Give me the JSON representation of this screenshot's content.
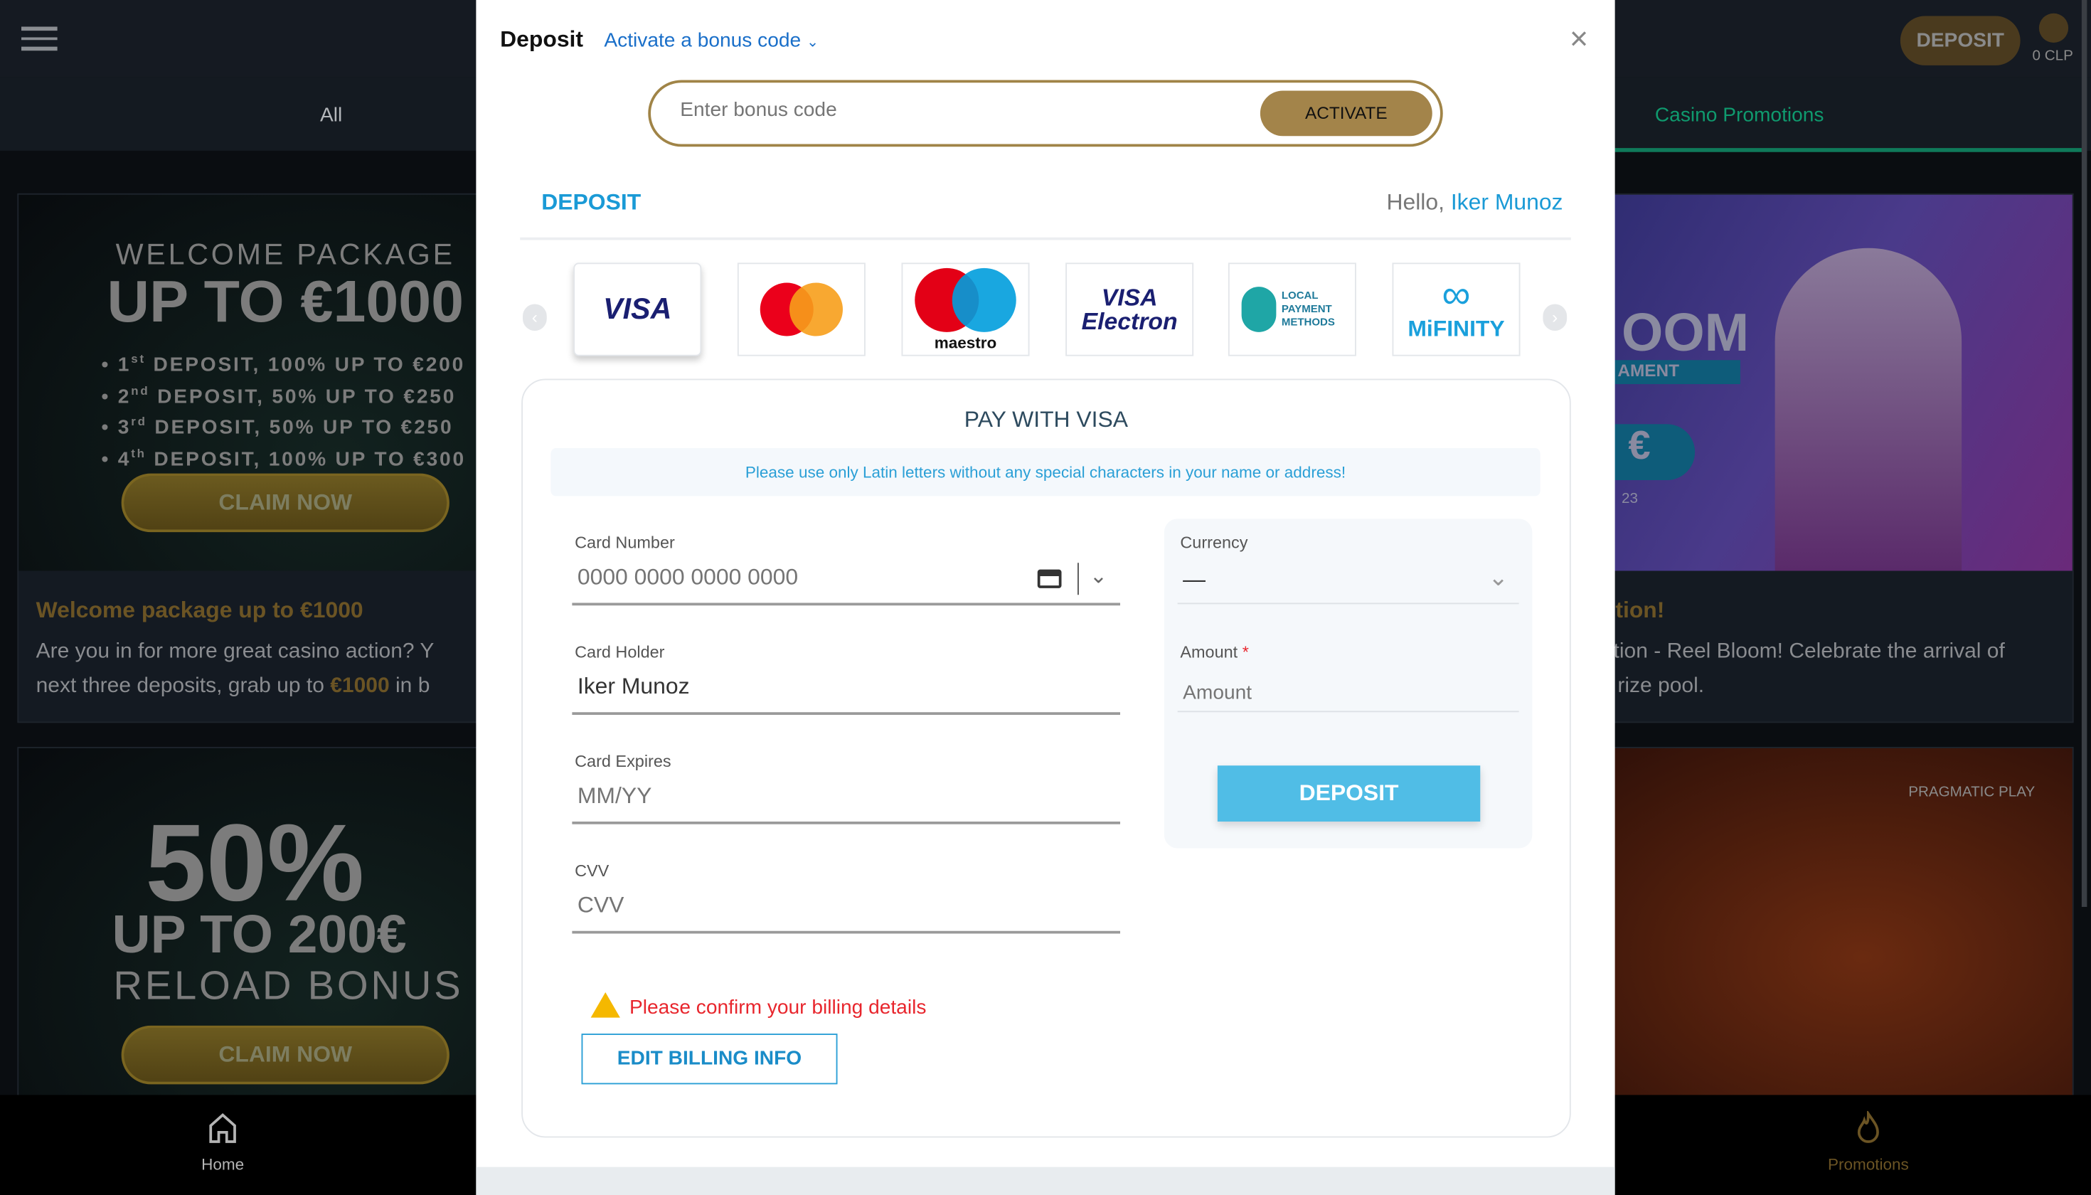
{
  "header": {
    "all_tab": "All",
    "promotions_tab": "Casino Promotions",
    "deposit_button": "DEPOSIT",
    "balance": "0 CLP"
  },
  "cards": {
    "welcome": {
      "banner_top": "WELCOME PACKAGE",
      "banner_big": "UP TO €1000",
      "lines": [
        [
          "1",
          "st",
          " DEPOSIT, 100% UP TO €200"
        ],
        [
          "2",
          "nd",
          " DEPOSIT, 50% UP TO €250"
        ],
        [
          "3",
          "rd",
          " DEPOSIT, 50% UP TO €250"
        ],
        [
          "4",
          "th",
          " DEPOSIT, 100% UP TO €300"
        ]
      ],
      "claim": "CLAIM NOW",
      "title": "Welcome package up to €1000",
      "text1": "Are you in for more great casino action? Y",
      "text2a": "next three deposits, grab up to ",
      "text2b": "€1000",
      "text2c": " in b"
    },
    "reload": {
      "big1": "50%",
      "big2": "UP TO 200€",
      "sub": "RELOAD BONUS",
      "claim": "CLAIM NOW"
    },
    "bloom": {
      "banner1": "OOM",
      "banner2": "AMENT",
      "banner3": "€",
      "banner4": "23",
      "title": "otion!",
      "text1": "otion - Reel Bloom! Celebrate the arrival of",
      "text2": "rize pool."
    },
    "pragmatic": {
      "brand": "PRAGMATIC PLAY"
    }
  },
  "bottom_nav": {
    "home": "Home",
    "promotions": "Promotions"
  },
  "modal": {
    "title": "Deposit",
    "bonus_link": "Activate a bonus code",
    "close": "×",
    "bonus_placeholder": "Enter bonus code",
    "activate": "ACTIVATE",
    "section": "DEPOSIT",
    "hello": "Hello,",
    "user": "Iker Munoz",
    "methods": [
      "VISA",
      "Mastercard",
      "maestro",
      "VISA Electron",
      "LOCAL PAYMENT METHODS",
      "MiFINITY"
    ],
    "pay_title": "PAY WITH VISA",
    "notice": "Please use only Latin letters without any special characters in your name or address!",
    "card_number_label": "Card Number",
    "card_number_placeholder": "0000 0000 0000 0000",
    "card_holder_label": "Card Holder",
    "card_holder_value": "Iker Munoz",
    "expires_label": "Card Expires",
    "expires_placeholder": "MM/YY",
    "cvv_label": "CVV",
    "cvv_placeholder": "CVV",
    "currency_label": "Currency",
    "currency_value": "—",
    "amount_label": "Amount",
    "required": "*",
    "amount_placeholder": "Amount",
    "deposit_button": "DEPOSIT",
    "warning": "Please confirm your billing details",
    "edit_billing": "EDIT BILLING INFO"
  },
  "colors": {
    "accent_gold": "#a3844a",
    "accent_blue": "#2a9fd6",
    "deposit_btn": "#50bde6",
    "warning_red": "#e8262d"
  }
}
